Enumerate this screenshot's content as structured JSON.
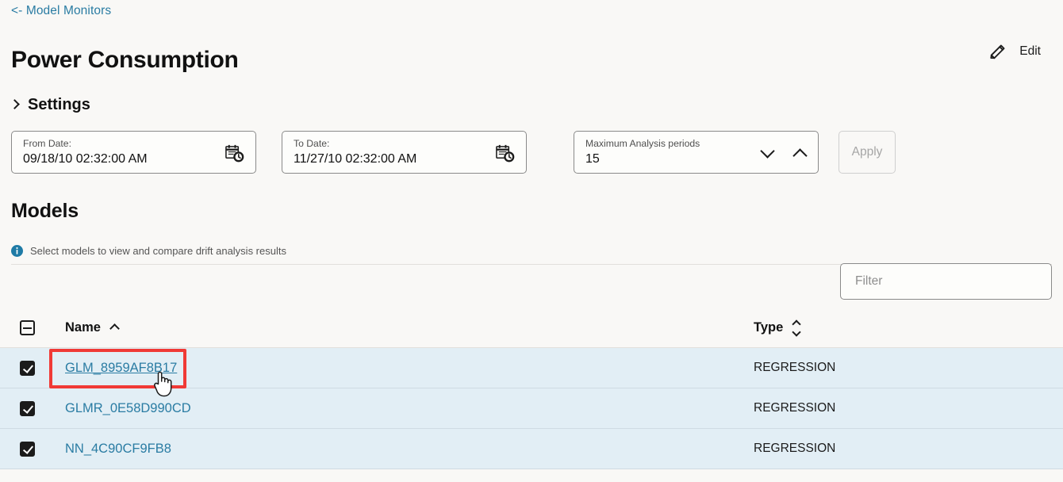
{
  "breadcrumb": {
    "label": "<- Model Monitors"
  },
  "header": {
    "title": "Power Consumption",
    "edit_label": "Edit",
    "edit_icon": "pencil-icon"
  },
  "settings": {
    "label": "Settings",
    "expand_icon": "chevron-right-icon",
    "fields": {
      "from_date": {
        "label": "From Date:",
        "value": "09/18/10 02:32:00 AM",
        "icon": "calendar-clock-icon"
      },
      "to_date": {
        "label": "To Date:",
        "value": "11/27/10 02:32:00 AM",
        "icon": "calendar-clock-icon"
      },
      "max_periods": {
        "label": "Maximum Analysis periods",
        "value": "15",
        "decrement_icon": "chevron-down-icon",
        "increment_icon": "chevron-up-icon"
      }
    },
    "apply_label": "Apply"
  },
  "models": {
    "title": "Models",
    "hint_icon": "info-icon",
    "hint": "Select models to view and compare drift analysis results",
    "filter": {
      "placeholder": "Filter",
      "value": ""
    },
    "columns": [
      {
        "key": "name",
        "label": "Name",
        "sort": "asc",
        "sort_icon": "chevron-up-icon"
      },
      {
        "key": "type",
        "label": "Type",
        "sort": "none",
        "sort_icon": "sort-both-icon"
      }
    ],
    "select_all": {
      "state": "indeterminate",
      "icon": "checkbox-indeterminate-icon"
    },
    "rows": [
      {
        "checked": true,
        "name": "GLM_8959AF8B17",
        "type": "REGRESSION"
      },
      {
        "checked": true,
        "name": "GLMR_0E58D990CD",
        "type": "REGRESSION"
      },
      {
        "checked": true,
        "name": "NN_4C90CF9FB8",
        "type": "REGRESSION"
      }
    ]
  },
  "annotation": {
    "highlight_color": "#f03a36",
    "cursor_icon": "pointer-hand-cursor"
  },
  "colors": {
    "page_bg": "#f9f8f6",
    "link": "#2a7ca3",
    "row_bg": "#e2eef5",
    "info_blue": "#1f7ba6"
  }
}
